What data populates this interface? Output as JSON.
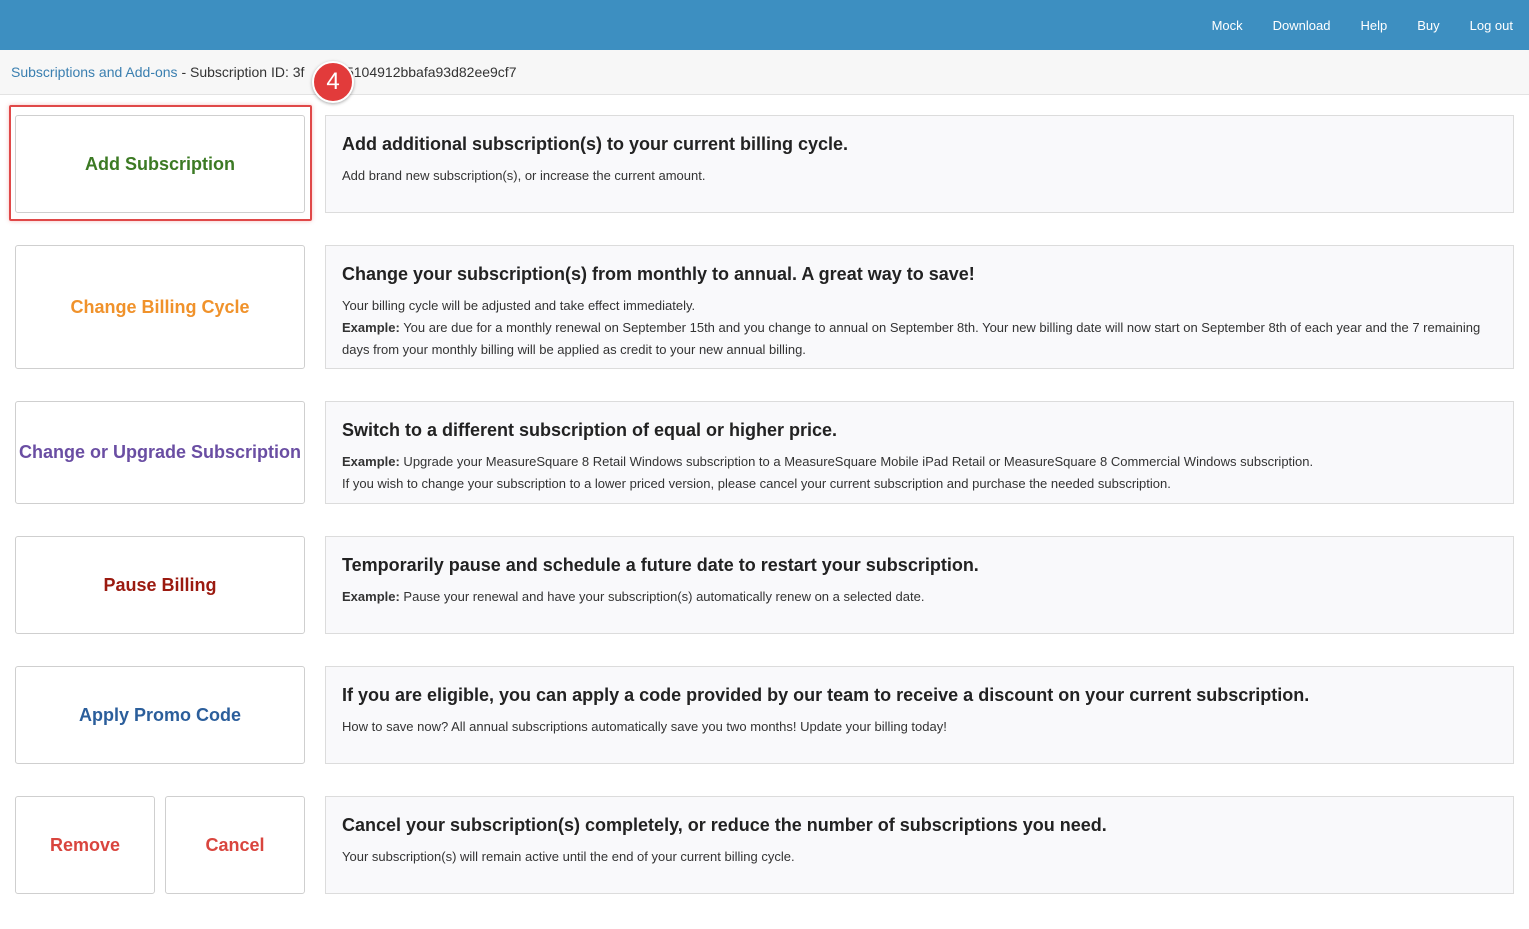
{
  "nav": [
    "Mock",
    "Download",
    "Help",
    "Buy",
    "Log out"
  ],
  "breadcrumb": {
    "link": "Subscriptions and Add-ons",
    "separator": " - ",
    "id_label": "Subscription ID: 3f",
    "id_value_tail": "935104912bbafa93d82ee9cf7"
  },
  "step_badge": "4",
  "colors": {
    "topbar": "#3d8fc1",
    "add": "#3c7a24",
    "billing": "#f0922b",
    "upgrade": "#6a4ea3",
    "pause": "#9b1a10",
    "promo": "#2b5e9b",
    "remove": "#d9453e"
  },
  "actions": {
    "add_subscription": {
      "label": "Add Subscription",
      "title": "Add additional subscription(s) to your current billing cycle.",
      "line1": "Add brand new subscription(s), or increase the current amount."
    },
    "change_billing": {
      "label": "Change Billing Cycle",
      "title": "Change your subscription(s) from monthly to annual. A great way to save!",
      "line1": "Your billing cycle will be adjusted and take effect immediately.",
      "example_label": "Example:",
      "example_text": " You are due for a monthly renewal on September 15th and you change to annual on September 8th. Your new billing date will now start on September 8th of each year and the 7 remaining days from your monthly billing will be applied as credit to your new annual billing."
    },
    "upgrade": {
      "label": "Change or Upgrade Subscription",
      "title": "Switch to a different subscription of equal or higher price.",
      "example_label": "Example:",
      "example_text": " Upgrade your MeasureSquare 8 Retail Windows subscription to a MeasureSquare Mobile iPad Retail or MeasureSquare 8 Commercial Windows subscription.",
      "line2": "If you wish to change your subscription to a lower priced version, please cancel your current subscription and purchase the needed subscription."
    },
    "pause": {
      "label": "Pause Billing",
      "title": "Temporarily pause and schedule a future date to restart your subscription.",
      "example_label": "Example:",
      "example_text": " Pause your renewal and have your subscription(s) automatically renew on a selected date."
    },
    "promo": {
      "label": "Apply Promo Code",
      "title": "If you are eligible, you can apply a code provided by our team to receive a discount on your current subscription.",
      "line1": "How to save now? All annual subscriptions automatically save you two months! Update your billing today!"
    },
    "cancel": {
      "remove_label": "Remove",
      "cancel_label": "Cancel",
      "title": "Cancel your subscription(s) completely, or reduce the number of subscriptions you need.",
      "line1": "Your subscription(s) will remain active until the end of your current billing cycle."
    }
  }
}
